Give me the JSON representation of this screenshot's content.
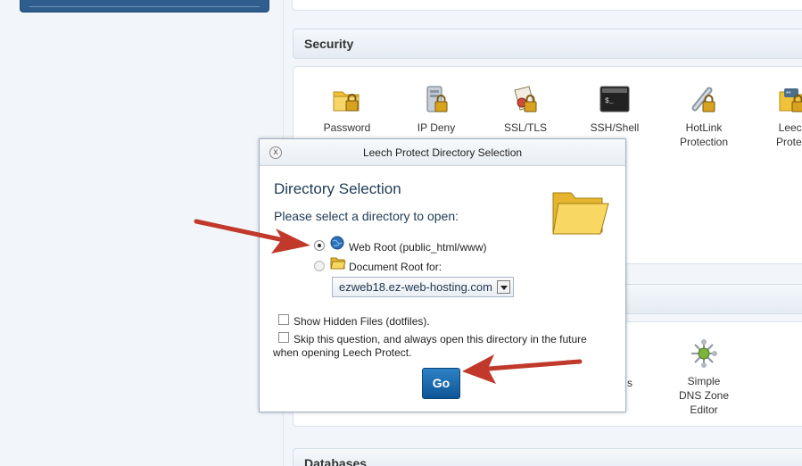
{
  "security": {
    "title": "Security",
    "items": [
      {
        "label": "Password Protect Directories",
        "visible_label": "Password",
        "icon": "folder-lock-icon"
      },
      {
        "label": "IP Deny Manager",
        "visible_label": "IP Deny",
        "icon": "server-lock-icon"
      },
      {
        "label": "SSL/TLS Manager",
        "visible_label": "SSL/TLS",
        "icon": "certificate-lock-icon"
      },
      {
        "label": "SSH/Shell Access",
        "visible_label": "SSH/Shell",
        "icon": "terminal-icon"
      },
      {
        "label": "HotLink Protection",
        "line1": "HotLink",
        "line2": "Protection",
        "icon": "chain-lock-icon"
      },
      {
        "label": "Leech Protect",
        "line1": "Leech",
        "line2": "Protect",
        "icon": "leech-lock-icon"
      }
    ]
  },
  "domains": {
    "simple_dns": {
      "line1": "Simple",
      "line2": "DNS Zone",
      "line3": "Editor",
      "icon": "dns-zone-icon"
    },
    "partial_label": "s"
  },
  "databases": {
    "title": "Databases"
  },
  "modal": {
    "title": "Leech Protect Directory Selection",
    "close_symbol": "x",
    "heading": "Directory Selection",
    "prompt": "Please select a directory to open:",
    "options": {
      "web_root": "Web Root (public_html/www)",
      "document_root": "Document Root for:"
    },
    "selected_option": "web_root",
    "domain_select": {
      "value": "ezweb18.ez-web-hosting.com"
    },
    "checkbox_hidden": "Show Hidden Files (dotfiles).",
    "checkbox_skip_line1": "Skip this question, and always open this directory in the future",
    "checkbox_skip_line2": "when opening Leech Protect.",
    "go_label": "Go"
  },
  "colors": {
    "arrow": "#c0392b",
    "go_button": "#1a6fb5",
    "heading": "#1e3b56"
  }
}
